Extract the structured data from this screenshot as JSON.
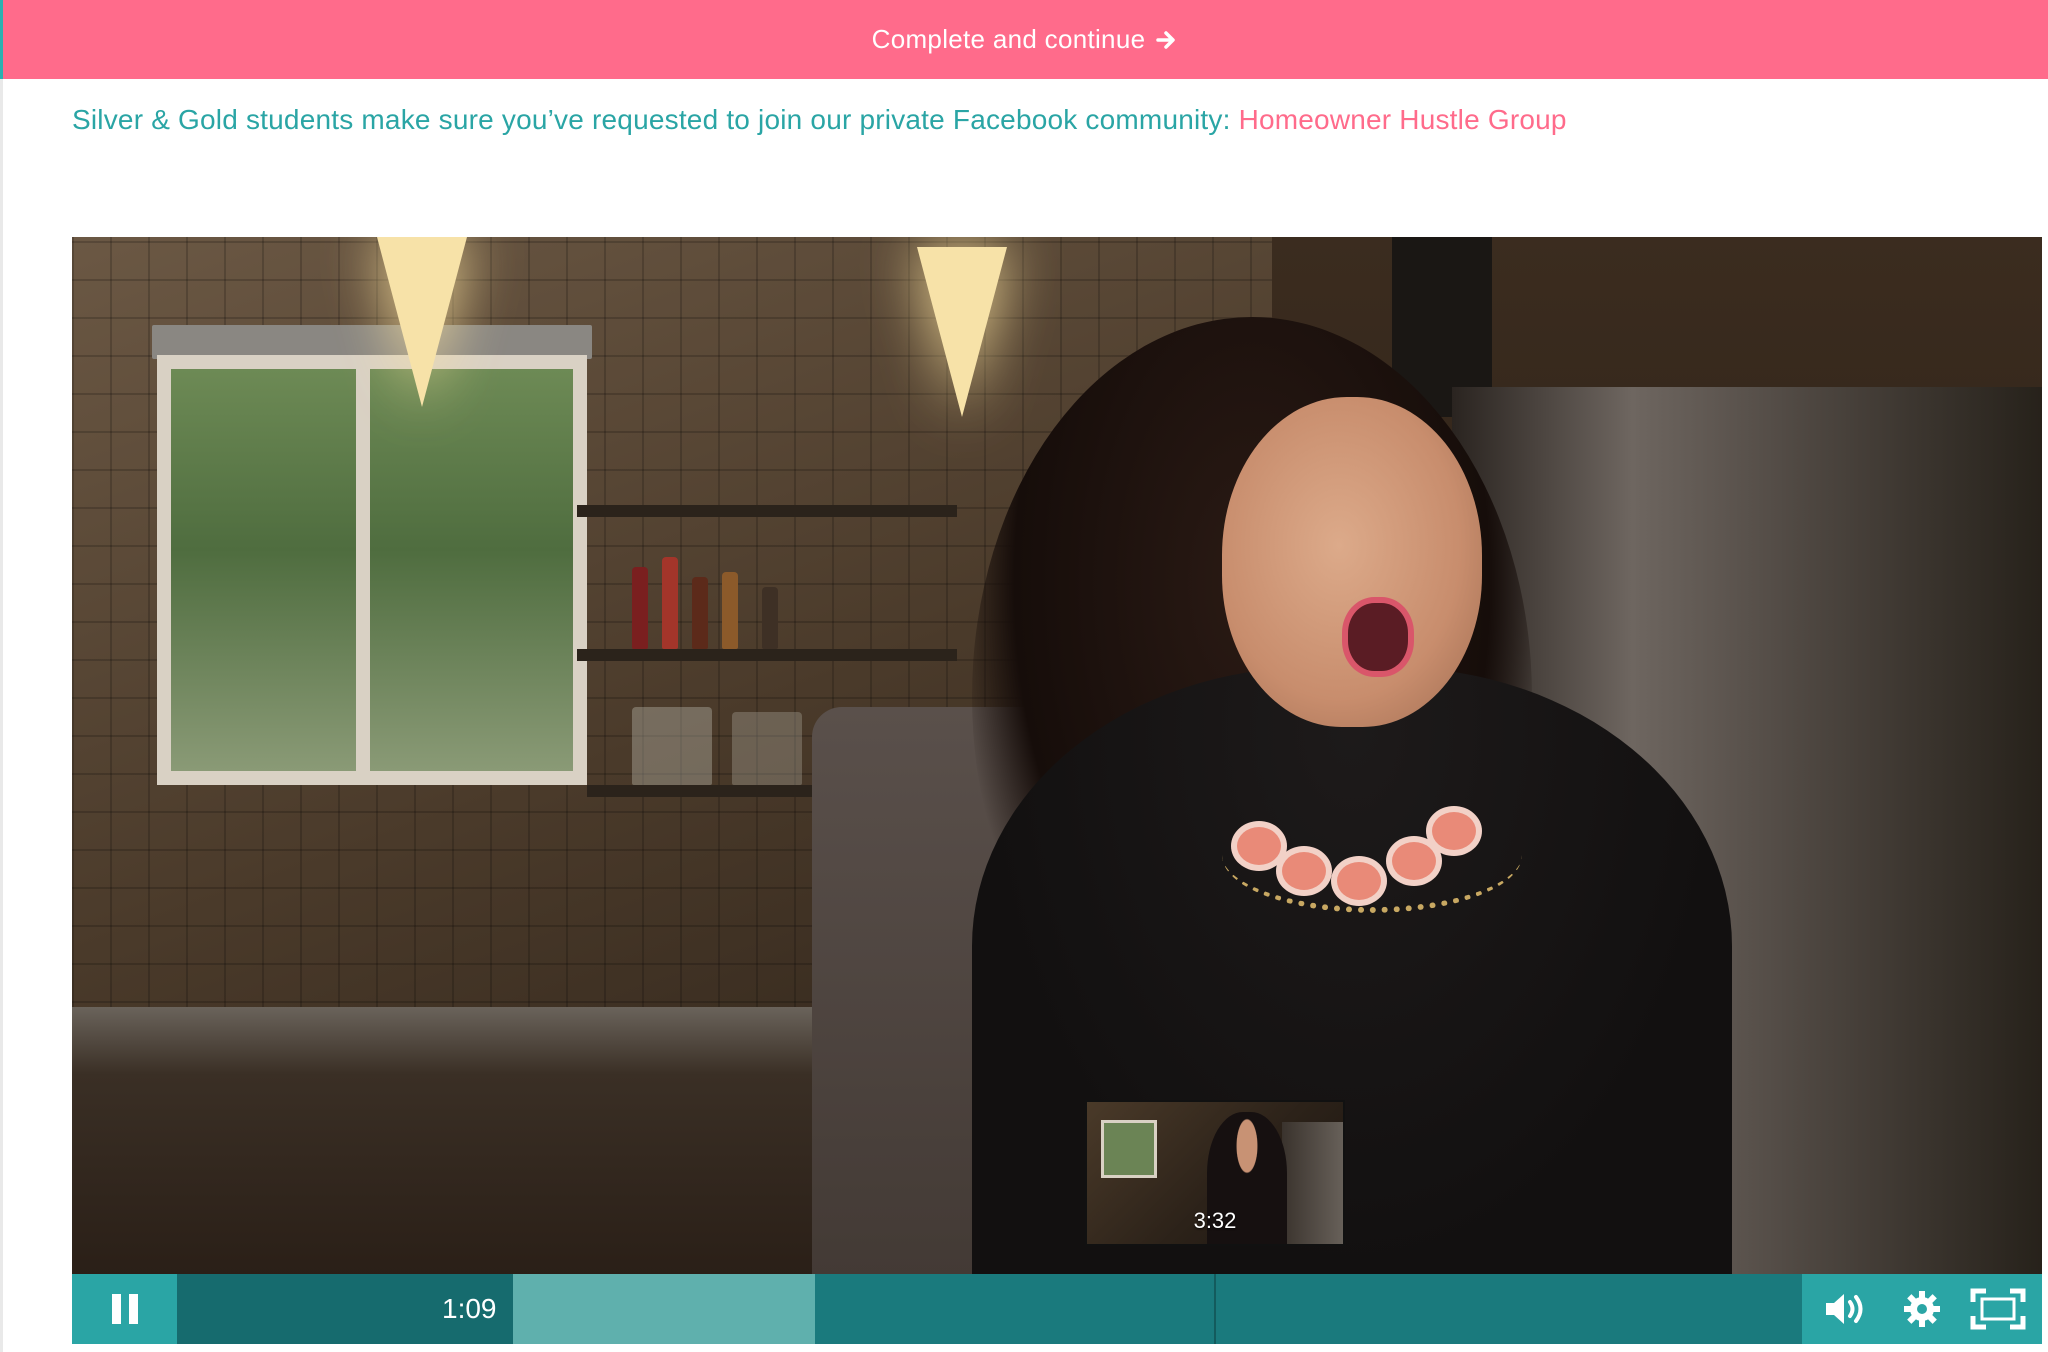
{
  "top_bar": {
    "button_label": "Complete and continue",
    "arrow_icon": "arrow-right-icon",
    "color": "#ff6b8b"
  },
  "notice": {
    "text": "Silver & Gold students make sure you’ve requested to join our private Facebook community: ",
    "link_text": "Homeowner Hustle Group",
    "text_color": "#2aa5a5",
    "link_color": "#ff6b8b"
  },
  "player": {
    "current_time": "1:09",
    "preview_time": "3:32",
    "accent_color": "#2aa5a5",
    "icons": {
      "play_pause": "pause-icon",
      "volume": "volume-icon",
      "settings": "gear-icon",
      "fullscreen": "fullscreen-icon"
    }
  }
}
